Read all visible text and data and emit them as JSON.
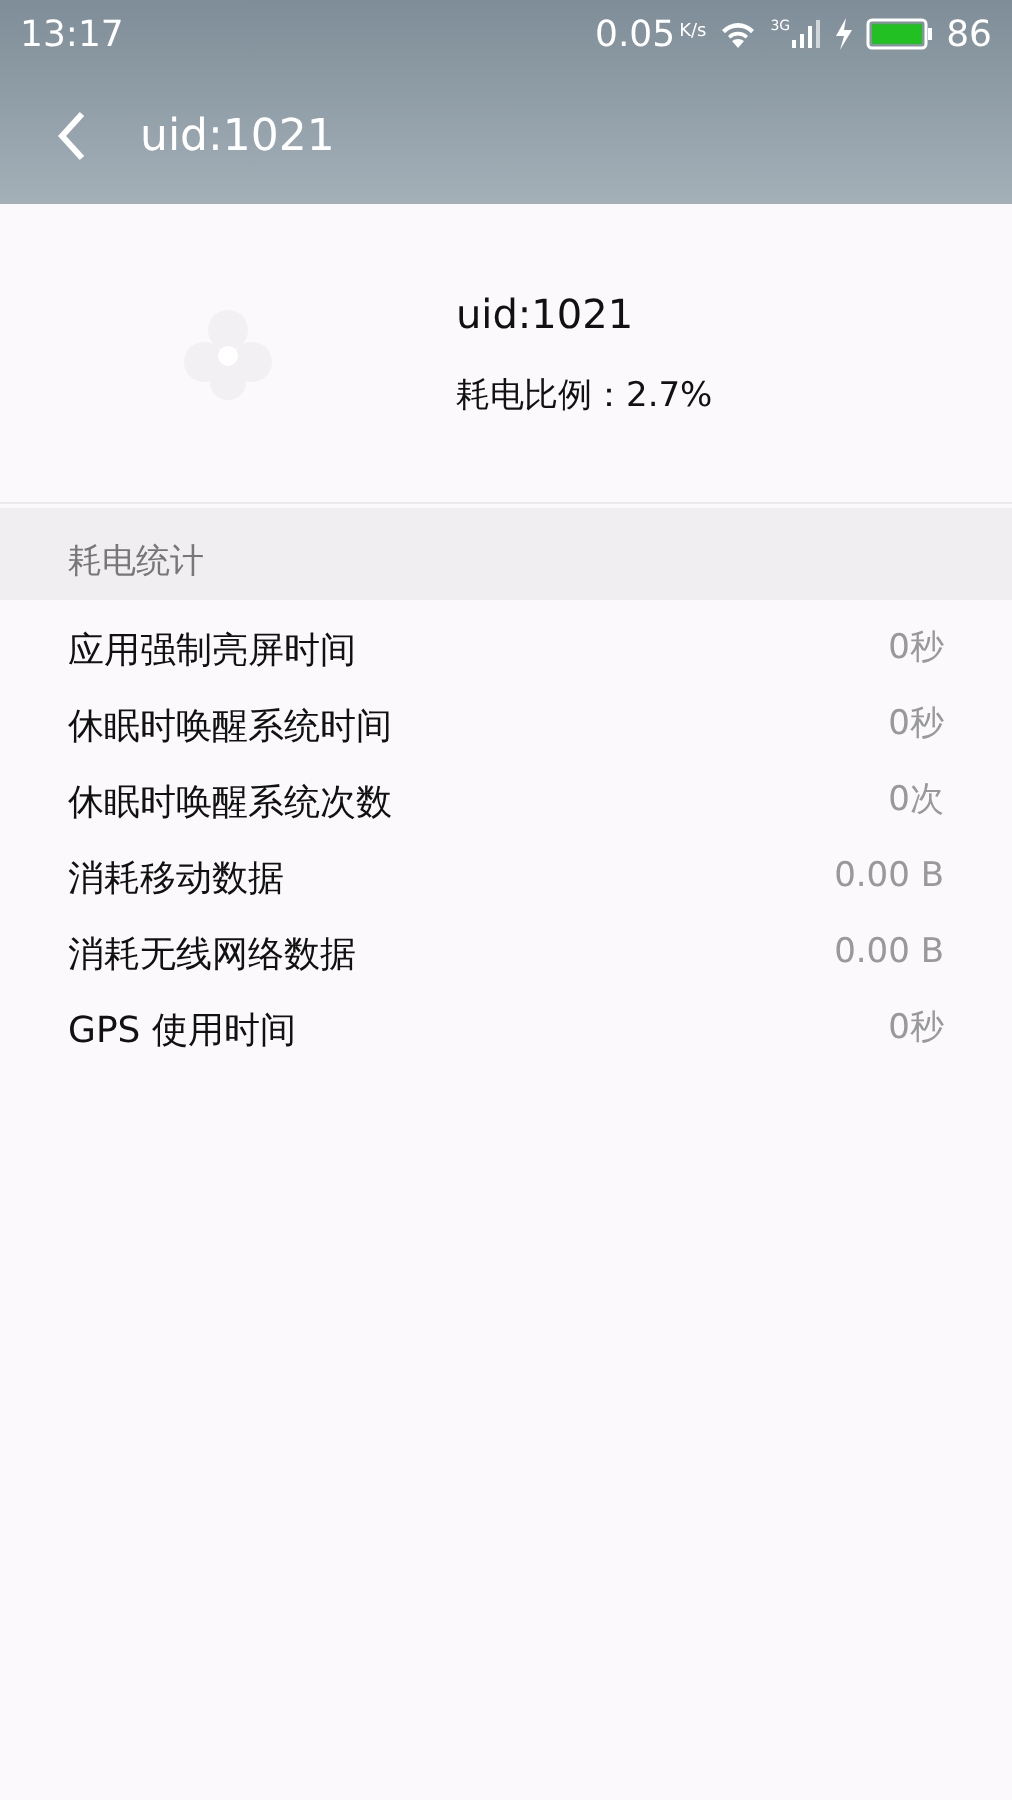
{
  "status_bar": {
    "time": "13:17",
    "net_speed": "0.05",
    "net_unit": "K/s",
    "network_type": "3G",
    "battery": "86"
  },
  "header": {
    "title": "uid:1021"
  },
  "app_info": {
    "name": "uid:1021",
    "ratio": "耗电比例：2.7%"
  },
  "section": {
    "title": "耗电统计"
  },
  "stats": [
    {
      "label": "应用强制亮屏时间",
      "value": "0秒"
    },
    {
      "label": "休眠时唤醒系统时间",
      "value": "0秒"
    },
    {
      "label": "休眠时唤醒系统次数",
      "value": "0次"
    },
    {
      "label": "消耗移动数据",
      "value": "0.00 B"
    },
    {
      "label": "消耗无线网络数据",
      "value": "0.00 B"
    },
    {
      "label": "GPS 使用时间",
      "value": "0秒"
    }
  ]
}
